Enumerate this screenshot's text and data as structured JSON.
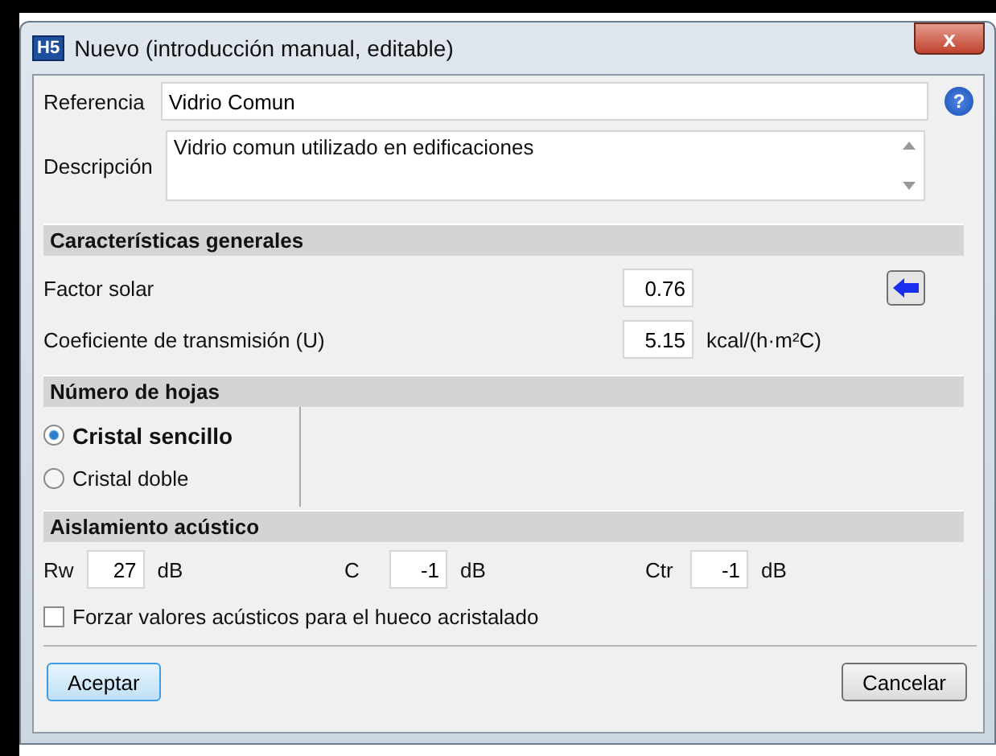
{
  "window": {
    "title": "Nuevo (introducción manual, editable)",
    "app_badge": "H5",
    "close": "x"
  },
  "reference": {
    "label": "Referencia",
    "value": "Vidrio Comun",
    "help": "?"
  },
  "description": {
    "label": "Descripción",
    "value": "Vidrio comun utilizado en edificaciones"
  },
  "general": {
    "title": "Características generales",
    "rows": [
      {
        "label": "Factor solar",
        "value": "0.76",
        "kind": "action"
      },
      {
        "label": "Coeficiente de transmisión (U)",
        "value": "5.15",
        "unit": "kcal/(h·m²C)",
        "kind": "unit"
      }
    ]
  },
  "sheets": {
    "title": "Número de hojas",
    "options": [
      {
        "label": "Cristal sencillo",
        "selected": true
      },
      {
        "label": "Cristal doble",
        "selected": false
      }
    ]
  },
  "acoustic": {
    "title": "Aislamiento acústico",
    "fields": [
      {
        "label": "Rw",
        "value": "27",
        "unit": "dB"
      },
      {
        "label": "C",
        "value": "-1",
        "unit": "dB"
      },
      {
        "label": "Ctr",
        "value": "-1",
        "unit": "dB"
      }
    ],
    "force": {
      "label": "Forzar valores acústicos para el hueco acristalado",
      "checked": false
    }
  },
  "buttons": [
    {
      "label": "Aceptar",
      "kind": "default"
    },
    {
      "label": "Cancelar",
      "kind": "normal"
    }
  ]
}
